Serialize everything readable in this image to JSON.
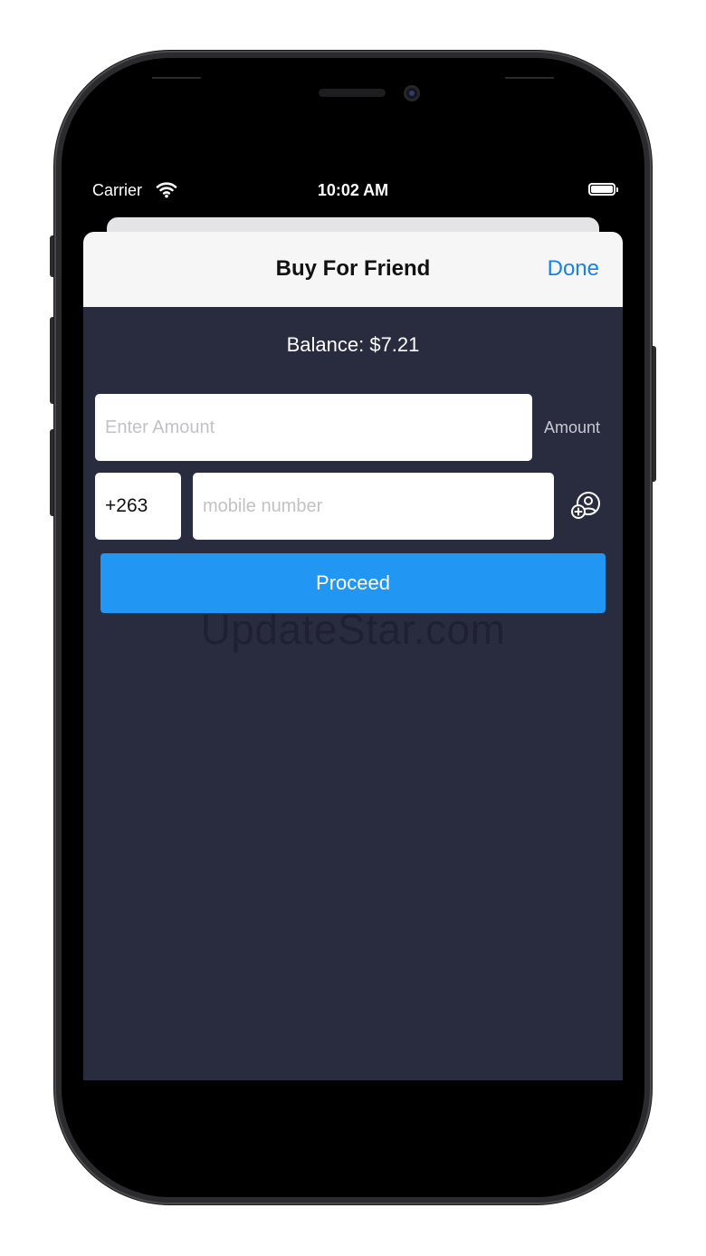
{
  "status_bar": {
    "carrier": "Carrier",
    "time": "10:02 AM",
    "wifi_icon": "wifi-icon",
    "battery_icon": "battery-full-icon"
  },
  "nav": {
    "title": "Buy For Friend",
    "done_label": "Done"
  },
  "balance": {
    "text": "Balance: $7.21"
  },
  "amount": {
    "placeholder": "Enter Amount",
    "value": "",
    "side_label": "Amount"
  },
  "mobile": {
    "country_code": "+263",
    "placeholder": "mobile number",
    "value": "",
    "contact_icon": "add-contact-icon"
  },
  "actions": {
    "proceed_label": "Proceed"
  },
  "watermark": {
    "text": "UpdateStar.com"
  },
  "colors": {
    "sheet_background": "#292b3f",
    "nav_background": "#f6f6f6",
    "accent_blue": "#1a82e2",
    "proceed_blue": "#2196f3"
  }
}
